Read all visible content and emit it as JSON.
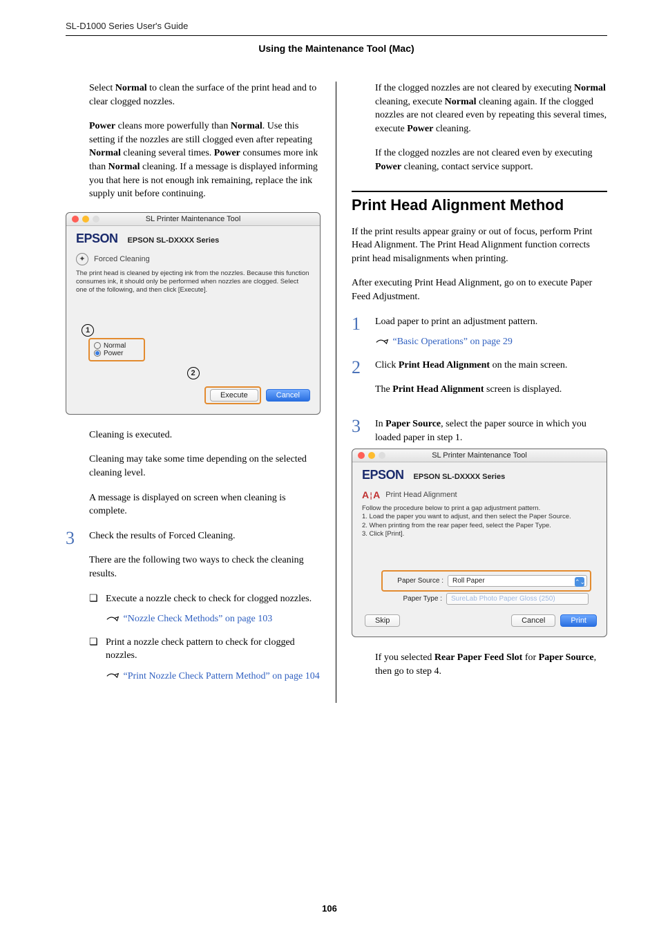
{
  "header": {
    "guide": "SL-D1000 Series User's Guide",
    "section": "Using the Maintenance Tool (Mac)"
  },
  "left": {
    "p1": "Select <b>Normal</b> to clean the surface of the print head and to clear clogged nozzles.",
    "p2": "<b>Power</b> cleans more powerfully than <b>Normal</b>. Use this setting if the nozzles are still clogged even after repeating <b>Normal</b> cleaning several times. <b>Power</b> consumes more ink than <b>Normal</b> cleaning. If a message is displayed informing you that here is not enough ink remaining, replace the ink supply unit before continuing.",
    "afterImg1": "Cleaning is executed.",
    "afterImg2": "Cleaning may take some time depending on the selected cleaning level.",
    "afterImg3": "A message is displayed on screen when cleaning is complete.",
    "step3": "Check the results of Forced Cleaning.",
    "step3b": "There are the following two ways to check the cleaning results.",
    "bul1": "Execute a nozzle check to check for clogged nozzles.",
    "link1": "“Nozzle Check Methods” on page 103",
    "bul2": "Print a nozzle check pattern to check for clogged nozzles.",
    "link2": "“Print Nozzle Check Pattern Method” on page 104"
  },
  "right": {
    "top1": "If the clogged nozzles are not cleared by executing <b>Normal</b> cleaning, execute <b>Normal</b> cleaning again. If the clogged nozzles are not cleared even by repeating this several times, execute <b>Power</b> cleaning.",
    "top2": "If the clogged nozzles are not cleared even by executing <b>Power</b> cleaning, contact service support.",
    "h2": "Print Head Alignment Method",
    "intro1": "If the print results appear grainy or out of focus, perform Print Head Alignment. The Print Head Alignment function corrects print head misalignments when printing.",
    "intro2": "After executing Print Head Alignment, go on to execute Paper Feed Adjustment.",
    "s1": "Load paper to print an adjustment pattern.",
    "s1link": "“Basic Operations” on page 29",
    "s2a": "Click <b>Print Head Alignment</b> on the main screen.",
    "s2b": "The <b>Print Head Alignment</b> screen is displayed.",
    "s3": "In <b>Paper Source</b>, select the paper source in which you loaded paper in step 1.",
    "after": "If you selected <b>Rear Paper Feed Slot</b> for <b>Paper Source</b>, then go to step 4."
  },
  "dialog1": {
    "title": "SL Printer Maintenance Tool",
    "brand": "EPSON",
    "series": "EPSON SL-DXXXX Series",
    "tool": "Forced Cleaning",
    "desc": "The print head is cleaned by ejecting ink from the nozzles. Because this function consumes ink, it should only be performed when nozzles are clogged. Select one of the following, and then click [Execute].",
    "opt1": "Normal",
    "opt2": "Power",
    "btnExec": "Execute",
    "btnCancel": "Cancel",
    "c1": "1",
    "c2": "2"
  },
  "dialog2": {
    "title": "SL Printer Maintenance Tool",
    "brand": "EPSON",
    "series": "EPSON SL-DXXXX Series",
    "tool": "Print Head Alignment",
    "desc": "Follow the procedure below to print a gap adjustment pattern.\n1. Load the paper you want to adjust, and then select the Paper Source.\n2. When printing from the rear paper feed, select the Paper Type.\n3. Click [Print].",
    "f1l": "Paper Source :",
    "f1v": "Roll Paper",
    "f2l": "Paper Type :",
    "f2v": "SureLab Photo Paper Gloss (250)",
    "btnSkip": "Skip",
    "btnCancel": "Cancel",
    "btnPrint": "Print"
  },
  "page": "106"
}
